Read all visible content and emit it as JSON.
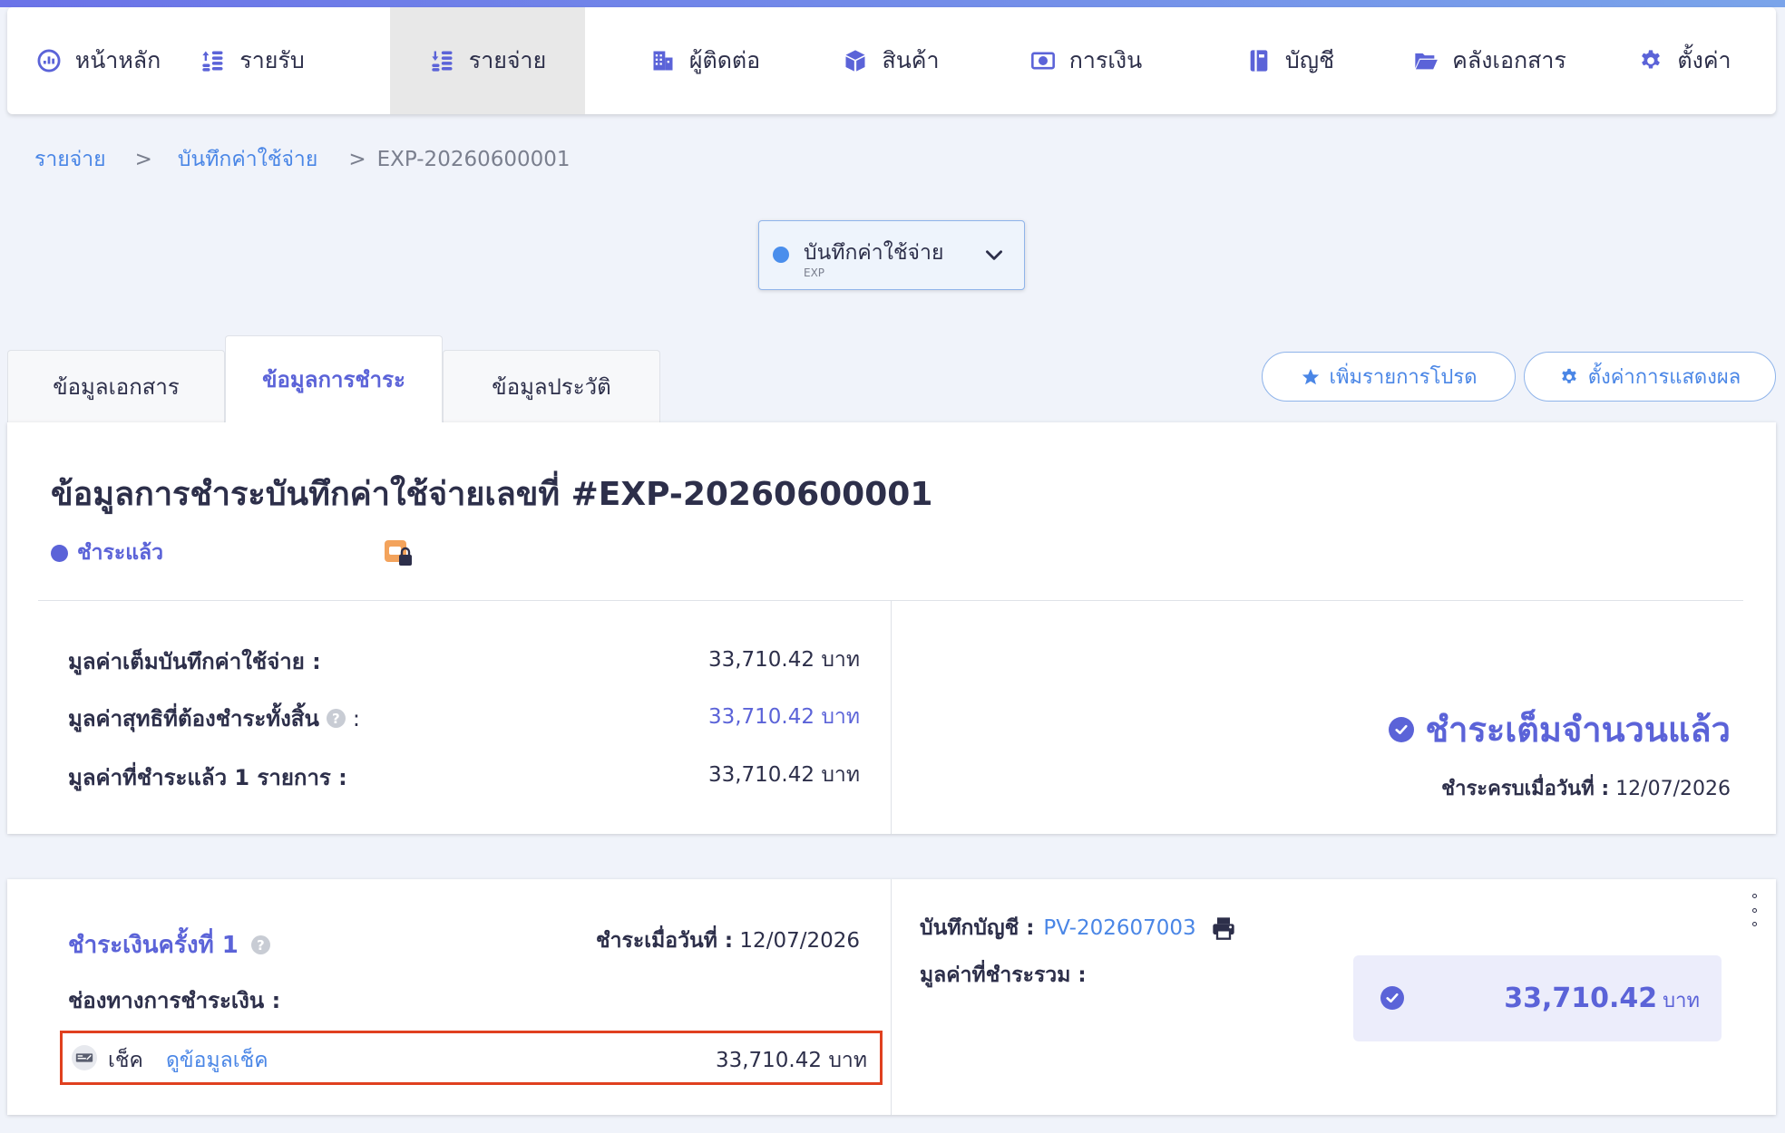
{
  "nav": {
    "items": [
      {
        "label": "หน้าหลัก",
        "icon": "dashboard-icon"
      },
      {
        "label": "รายรับ",
        "icon": "income-coins-icon"
      },
      {
        "label": "รายจ่าย",
        "icon": "expense-coins-icon",
        "active": true
      },
      {
        "label": "ผู้ติดต่อ",
        "icon": "contacts-building-icon"
      },
      {
        "label": "สินค้า",
        "icon": "product-box-icon"
      },
      {
        "label": "การเงิน",
        "icon": "money-bill-icon"
      },
      {
        "label": "บัญชี",
        "icon": "account-book-icon"
      },
      {
        "label": "คลังเอกสาร",
        "icon": "folder-icon"
      },
      {
        "label": "ตั้งค่า",
        "icon": "gear-icon"
      }
    ]
  },
  "breadcrumb": {
    "level1": "รายจ่าย",
    "sep": ">",
    "level2": "บันทึกค่าใช้จ่าย",
    "current": "EXP-20260600001"
  },
  "doc_select": {
    "title": "บันทึกค่าใช้จ่าย",
    "code": "EXP"
  },
  "tabs": {
    "doc_info": "ข้อมูลเอกสาร",
    "payment_info": "ข้อมูลการชำระ",
    "history": "ข้อมูลประวัติ"
  },
  "actions": {
    "favorite": "เพิ่มรายการโปรด",
    "display_settings": "ตั้งค่าการแสดงผล"
  },
  "summary": {
    "title": "ข้อมูลการชำระบันทึกค่าใช้จ่ายเลขที่ #EXP-20260600001",
    "status": "ชำระแล้ว",
    "full_value_label": "มูลค่าเต็มบันทึกค่าใช้จ่าย :",
    "full_value": "33,710.42 บาท",
    "net_value_label": "มูลค่าสุทธิที่ต้องชำระทั้งสิ้น",
    "net_value_colon": ":",
    "net_value": "33,710.42 บาท",
    "paid_value_label": "มูลค่าที่ชำระแล้ว 1 รายการ :",
    "paid_value": "33,710.42 บาท",
    "paid_full_text": "ชำระเต็มจำนวนแล้ว",
    "paid_date_label": "ชำระครบเมื่อวันที่ :",
    "paid_date": "12/07/2026"
  },
  "payment": {
    "title": "ชำระเงินครั้งที่ 1",
    "date_label": "ชำระเมื่อวันที่ :",
    "date": "12/07/2026",
    "channel_label": "ช่องทางการชำระเงิน :",
    "method": "เช็ค",
    "method_link": "ดูข้อมูลเช็ค",
    "method_amount": "33,710.42 บาท",
    "account_label": "บันทึกบัญชี :",
    "account_doc": "PV-202607003",
    "total_label": "มูลค่าที่ชำระรวม :",
    "total_amount": "33,710.42",
    "total_unit": "บาท"
  },
  "colors": {
    "accent": "#5b63d8",
    "link": "#4a86e6",
    "highlight_border": "#e0401f"
  }
}
